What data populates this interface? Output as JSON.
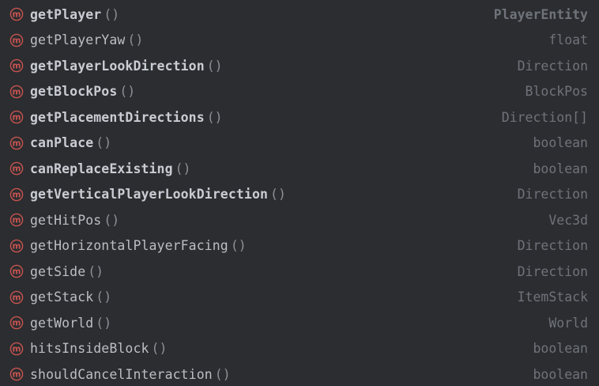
{
  "colors": {
    "background": "#2b2d30",
    "method_icon": "#c75450",
    "name_text": "#bcbec4",
    "type_text": "#6f737a"
  },
  "icon_name": "method-icon",
  "icon_glyph": "m",
  "items": [
    {
      "name": "getPlayer",
      "params": "()",
      "type": "PlayerEntity",
      "bold": true
    },
    {
      "name": "getPlayerYaw",
      "params": "()",
      "type": "float",
      "bold": false
    },
    {
      "name": "getPlayerLookDirection",
      "params": "()",
      "type": "Direction",
      "bold": true
    },
    {
      "name": "getBlockPos",
      "params": "()",
      "type": "BlockPos",
      "bold": true
    },
    {
      "name": "getPlacementDirections",
      "params": "()",
      "type": "Direction[]",
      "bold": true
    },
    {
      "name": "canPlace",
      "params": "()",
      "type": "boolean",
      "bold": true
    },
    {
      "name": "canReplaceExisting",
      "params": "()",
      "type": "boolean",
      "bold": true
    },
    {
      "name": "getVerticalPlayerLookDirection",
      "params": "()",
      "type": "Direction",
      "bold": true
    },
    {
      "name": "getHitPos",
      "params": "()",
      "type": "Vec3d",
      "bold": false
    },
    {
      "name": "getHorizontalPlayerFacing",
      "params": "()",
      "type": "Direction",
      "bold": false
    },
    {
      "name": "getSide",
      "params": "()",
      "type": "Direction",
      "bold": false
    },
    {
      "name": "getStack",
      "params": "()",
      "type": "ItemStack",
      "bold": false
    },
    {
      "name": "getWorld",
      "params": "()",
      "type": "World",
      "bold": false
    },
    {
      "name": "hitsInsideBlock",
      "params": "()",
      "type": "boolean",
      "bold": false
    },
    {
      "name": "shouldCancelInteraction",
      "params": "()",
      "type": "boolean",
      "bold": false
    }
  ]
}
